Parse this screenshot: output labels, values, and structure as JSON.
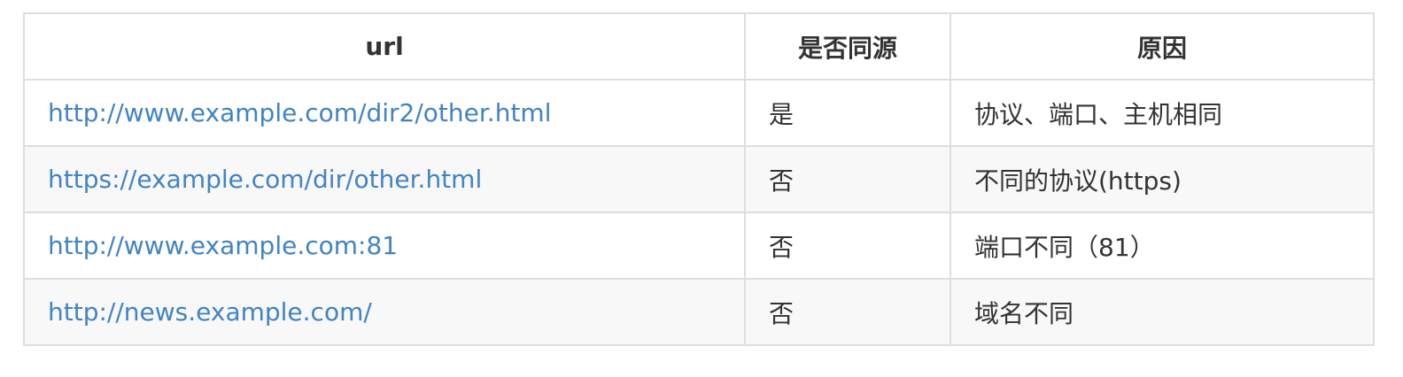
{
  "table": {
    "headers": {
      "url": "url",
      "same_origin": "是否同源",
      "reason": "原因"
    },
    "rows": [
      {
        "url": "http://www.example.com/dir2/other.html",
        "same_origin": "是",
        "reason": "协议、端口、主机相同"
      },
      {
        "url": "https://example.com/dir/other.html",
        "same_origin": "否",
        "reason": "不同的协议(https)"
      },
      {
        "url": "http://www.example.com:81",
        "same_origin": "否",
        "reason": "端口不同（81）"
      },
      {
        "url": "http://news.example.com/",
        "same_origin": "否",
        "reason": "域名不同"
      }
    ]
  },
  "colors": {
    "link": "#4183c4",
    "text": "#333333",
    "border": "#dedede",
    "stripe": "#f8f8f8"
  }
}
